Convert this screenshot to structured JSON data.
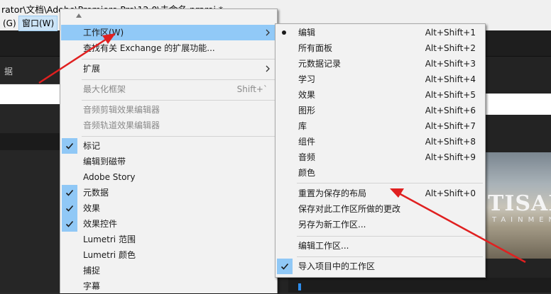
{
  "window": {
    "title": "rator\\文档\\Adobe\\Premiere Pro\\12.0\\未命名.prproj *"
  },
  "menubar": {
    "items": [
      {
        "label": "(G)"
      },
      {
        "label": "窗口(W)",
        "active": true
      }
    ]
  },
  "left_panel": {
    "tab_label": "据"
  },
  "preview": {
    "logo": "TISAN",
    "logo_sub": "TAINMENT"
  },
  "main_menu": {
    "items": [
      {
        "label": "工作区(W)",
        "highlighted": true,
        "submenu": true
      },
      {
        "label": "查找有关 Exchange 的扩展功能..."
      },
      {
        "label": "扩展",
        "submenu": true
      },
      {
        "label": "最大化框架",
        "shortcut": "Shift+`",
        "disabled": true
      },
      {
        "label": "音频剪辑效果编辑器",
        "disabled": true
      },
      {
        "label": "音频轨道效果编辑器",
        "disabled": true
      },
      {
        "label": "标记",
        "checked": true
      },
      {
        "label": "编辑到磁带"
      },
      {
        "label": "Adobe Story"
      },
      {
        "label": "元数据",
        "checked": true
      },
      {
        "label": "效果",
        "checked": true
      },
      {
        "label": "效果控件",
        "checked": true
      },
      {
        "label": "Lumetri 范围"
      },
      {
        "label": "Lumetri 颜色"
      },
      {
        "label": "捕捉"
      },
      {
        "label": "字幕"
      }
    ]
  },
  "workspace_menu": {
    "items": [
      {
        "label": "编辑",
        "shortcut": "Alt+Shift+1",
        "selected": true
      },
      {
        "label": "所有面板",
        "shortcut": "Alt+Shift+2"
      },
      {
        "label": "元数据记录",
        "shortcut": "Alt+Shift+3"
      },
      {
        "label": "学习",
        "shortcut": "Alt+Shift+4"
      },
      {
        "label": "效果",
        "shortcut": "Alt+Shift+5"
      },
      {
        "label": "图形",
        "shortcut": "Alt+Shift+6"
      },
      {
        "label": "库",
        "shortcut": "Alt+Shift+7"
      },
      {
        "label": "组件",
        "shortcut": "Alt+Shift+8"
      },
      {
        "label": "音频",
        "shortcut": "Alt+Shift+9"
      },
      {
        "label": "颜色"
      },
      {
        "label": "重置为保存的布局",
        "shortcut": "Alt+Shift+0"
      },
      {
        "label": "保存对此工作区所做的更改"
      },
      {
        "label": "另存为新工作区..."
      },
      {
        "label": "编辑工作区..."
      },
      {
        "label": "导入项目中的工作区",
        "checked": true
      }
    ]
  },
  "colors": {
    "highlight": "#91c9f7",
    "annotation_arrow": "#e02020",
    "menu_bg": "#f2f2f2"
  }
}
